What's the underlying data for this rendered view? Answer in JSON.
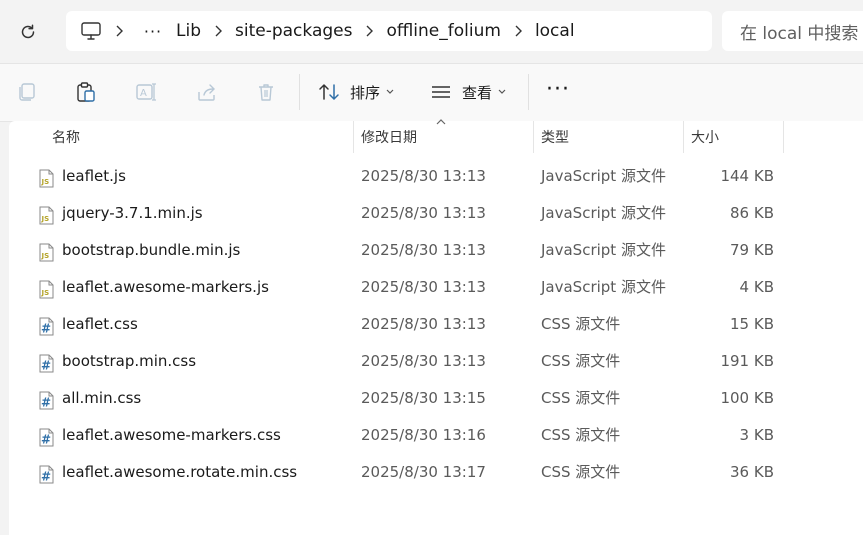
{
  "address_bar": {
    "more_label": "···",
    "segments": [
      "Lib",
      "site-packages",
      "offline_folium",
      "local"
    ]
  },
  "search": {
    "placeholder": "在 local 中搜索"
  },
  "toolbar": {
    "sort_label": "排序",
    "view_label": "查看",
    "more_label": "···"
  },
  "columns": {
    "name": "名称",
    "date": "修改日期",
    "type": "类型",
    "size": "大小"
  },
  "files": [
    {
      "name": "leaflet.js",
      "date": "2025/8/30 13:13",
      "type": "JavaScript 源文件",
      "size": "144 KB",
      "kind": "js"
    },
    {
      "name": "jquery-3.7.1.min.js",
      "date": "2025/8/30 13:13",
      "type": "JavaScript 源文件",
      "size": "86 KB",
      "kind": "js"
    },
    {
      "name": "bootstrap.bundle.min.js",
      "date": "2025/8/30 13:13",
      "type": "JavaScript 源文件",
      "size": "79 KB",
      "kind": "js"
    },
    {
      "name": "leaflet.awesome-markers.js",
      "date": "2025/8/30 13:13",
      "type": "JavaScript 源文件",
      "size": "4 KB",
      "kind": "js"
    },
    {
      "name": "leaflet.css",
      "date": "2025/8/30 13:13",
      "type": "CSS 源文件",
      "size": "15 KB",
      "kind": "css"
    },
    {
      "name": "bootstrap.min.css",
      "date": "2025/8/30 13:13",
      "type": "CSS 源文件",
      "size": "191 KB",
      "kind": "css"
    },
    {
      "name": "all.min.css",
      "date": "2025/8/30 13:15",
      "type": "CSS 源文件",
      "size": "100 KB",
      "kind": "css"
    },
    {
      "name": "leaflet.awesome-markers.css",
      "date": "2025/8/30 13:16",
      "type": "CSS 源文件",
      "size": "3 KB",
      "kind": "css"
    },
    {
      "name": "leaflet.awesome.rotate.min.css",
      "date": "2025/8/30 13:17",
      "type": "CSS 源文件",
      "size": "36 KB",
      "kind": "css"
    }
  ],
  "icons": {
    "js_file": "js-file-icon",
    "css_file": "css-file-icon"
  },
  "colors": {
    "js_icon": "#b5a42a",
    "css_icon": "#2f6fa7"
  }
}
